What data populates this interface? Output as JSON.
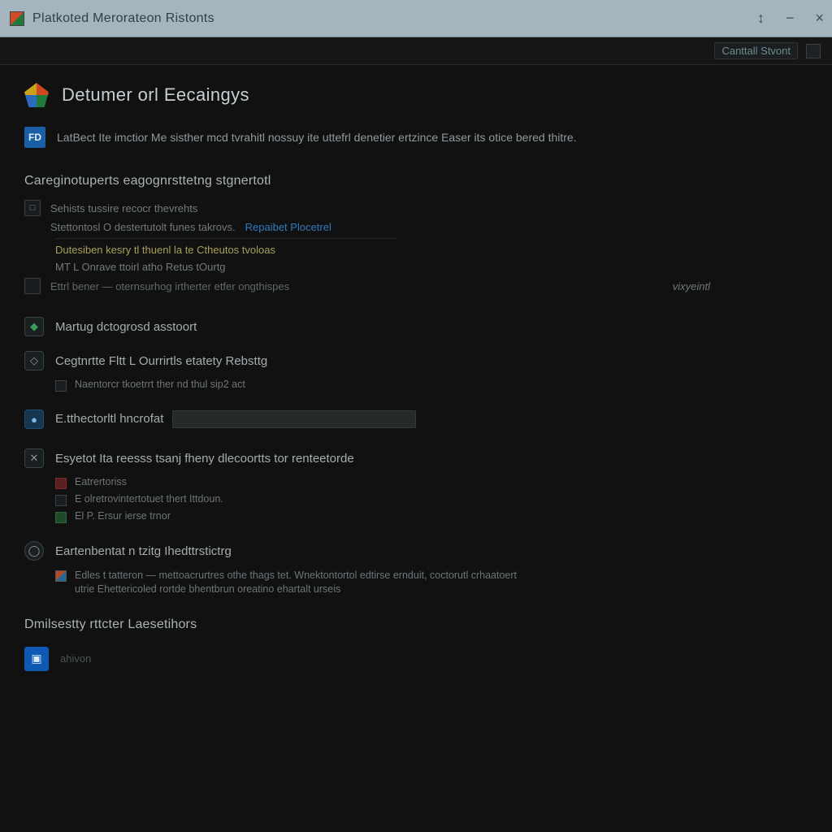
{
  "window": {
    "title": "Platkoted Merorateon Ristonts",
    "buttons": {
      "restore": "↕",
      "minimize": "−",
      "close": "×"
    }
  },
  "toolbar": {
    "action_label": "Canttall Stvont",
    "icon_hint": "≡"
  },
  "page": {
    "title": "Detumer orl Eecaingys",
    "info": "LatBect Ite imctior Me sisther mcd tvrahitl nossuy ite uttefrl denetier ertzince Easer its otice bered thitre."
  },
  "sec1": {
    "title": "Careginotuperts eagognrsttetng stgnertotl",
    "row1": "Sehists tussire recocr thevrehts",
    "row2a": "Stettontosl O destertutolt funes takrovs.",
    "row2b": "Repaibet Plocetrel",
    "row3": "Dutesiben kesry tl thuenl la te Ctheutos tvoloas",
    "row4": "MT L Onrave ttoirl atho Retus tOurtg",
    "row5": "Ettrl bener — oternsurhog irtherter etfer ongthispes",
    "row5_side": "vixyeintl"
  },
  "sec2": {
    "title": "Martug dctogrosd asstoort"
  },
  "sec3": {
    "title": "Cegtnrtte Fltt L Ourrirtls etatety Rebsttg",
    "sub": "Naentorcr tkoetrrt ther nd thul sip2 act"
  },
  "sec4": {
    "title": "E.tthectorltl hncrofat",
    "input_value": ""
  },
  "sec5": {
    "title": "Esyetot Ita reesss tsanj fheny dlecoortts tor renteetorde",
    "d1": "Eatrertoriss",
    "d2": "E olretrovintertotuet thert Ittdoun.",
    "d3": "El P. Ersur ierse trnor"
  },
  "sec6": {
    "title": "Eartenbentat n tzitg Ihedttrstictrg",
    "line": "Edles t tatteron — mettoacrurtres othe thags tet. Wnektontortol edtirse ernduit, coctorutl crhaatoert utrie Ehettericoled rortde bhentbrun oreatino ehartalt urseis"
  },
  "sec7": {
    "title": "Dmilsestty rttcter Laesetihors"
  },
  "bottom": {
    "label": "ahivon"
  }
}
